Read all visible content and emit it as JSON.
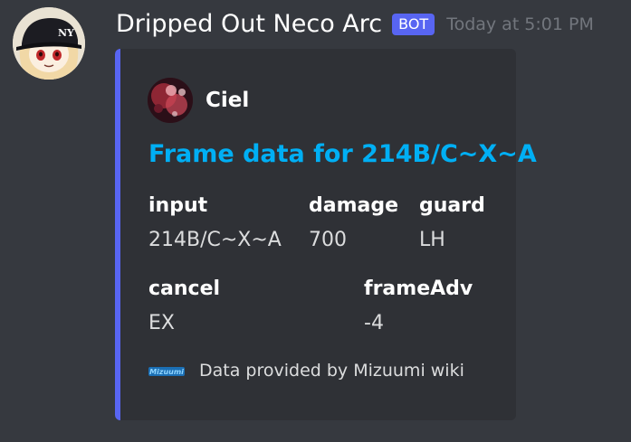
{
  "message": {
    "username": "Dripped Out Neco Arc",
    "bot_tag": "BOT",
    "timestamp": "Today at 5:01 PM"
  },
  "embed": {
    "accent_color": "#5865f2",
    "author": {
      "name": "Ciel"
    },
    "title": "Frame data for 214B/C~X~A",
    "fields": [
      {
        "name": "input",
        "value": "214B/C~X~A"
      },
      {
        "name": "damage",
        "value": "700"
      },
      {
        "name": "guard",
        "value": "LH"
      },
      {
        "name": "cancel",
        "value": "EX"
      },
      {
        "name": "frameAdv",
        "value": "-4"
      }
    ],
    "footer": {
      "icon_text": "Mizuumi",
      "text": "Data provided by Mizuumi wiki"
    }
  },
  "icons": {
    "avatar": "neco-arc-avatar-icon",
    "author": "ciel-author-icon",
    "footer": "mizuumi-logo-icon"
  }
}
